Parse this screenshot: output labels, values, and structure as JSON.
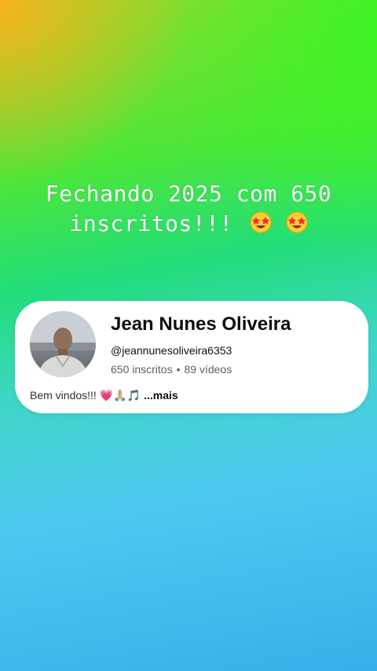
{
  "headline": {
    "line1": "Fechando 2025 com 650",
    "line2": "inscritos!!!"
  },
  "channel": {
    "name": "Jean Nunes Oliveira",
    "handle": "@jeannunesoliveira6353",
    "subscribers": "650 inscritos",
    "separator": "•",
    "videos": "89 vídeos",
    "description": "Bem vindos!!!",
    "description_emojis": "💗🙏🏼🎵",
    "more_label": "...mais"
  },
  "colors": {
    "card_bg": "#ffffff",
    "name_text": "#0f0f0f",
    "secondary_text": "#606060"
  },
  "icons": {
    "emoji": "star-struck-face-icon",
    "avatar": "channel-avatar"
  }
}
